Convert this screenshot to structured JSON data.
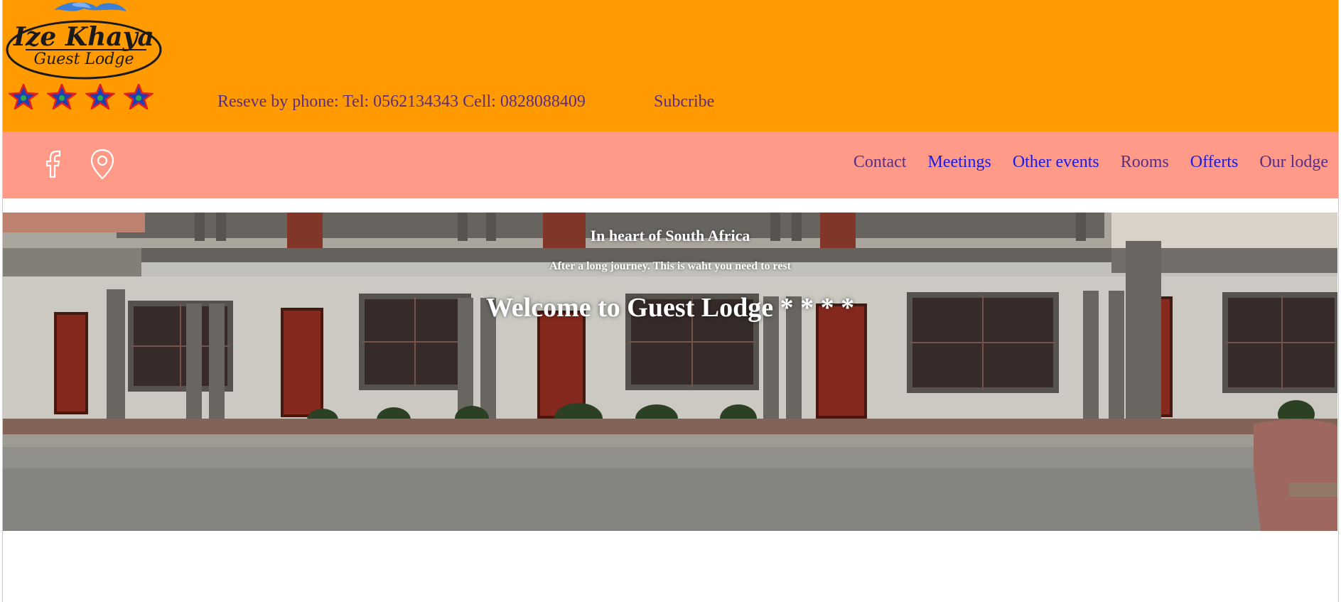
{
  "brand": {
    "name_line1": "Ize Khaya",
    "name_line2": "Guest Lodge",
    "star_rating": 4
  },
  "header": {
    "reserve_text": "Reseve by phone: Tel: 0562134343 Cell: 0828088409",
    "subscribe_label": "Subcribe"
  },
  "social": {
    "icons": [
      "facebook-icon",
      "map-pin-icon"
    ]
  },
  "nav": {
    "items": [
      {
        "label": "Contact",
        "visited": true
      },
      {
        "label": "Meetings",
        "visited": false
      },
      {
        "label": "Other events",
        "visited": false
      },
      {
        "label": "Rooms",
        "visited": true
      },
      {
        "label": "Offerts",
        "visited": false
      },
      {
        "label": "Our lodge",
        "visited": true
      }
    ]
  },
  "hero": {
    "tagline": "In heart of South Africa",
    "subtitle": "After a long journey. This is waht you need to rest",
    "title": "Welcome to Guest Lodge * * * *"
  },
  "colors": {
    "topbar": "#ff9b00",
    "navbar": "#ff9a88",
    "link_visited": "#5a2d82",
    "link": "#1a1ae6"
  }
}
